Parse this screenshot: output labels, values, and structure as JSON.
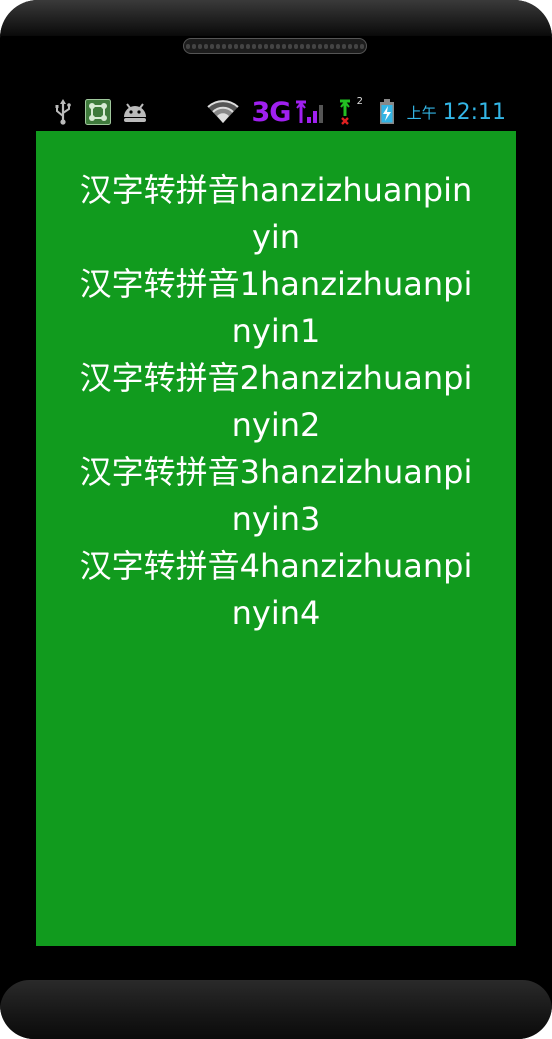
{
  "status_bar": {
    "icons": [
      "usb-icon",
      "app-notification-icon",
      "android-debug-icon",
      "wifi-icon",
      "network-3g-icon",
      "signal-icon",
      "sim-no-signal-icon",
      "battery-charging-icon"
    ],
    "network_label": "3G",
    "sim_slot_label": "2",
    "ampm": "上午",
    "time": "12:11"
  },
  "colors": {
    "screen_background": "#119b1e",
    "text": "#ffffff",
    "clock": "#33b5e5",
    "network_3g": "#a020f0"
  },
  "list": {
    "items": [
      {
        "chinese": "汉字转拼音",
        "pinyin": "hanzizhuanpinyin",
        "text": "汉字转拼音hanzizhuanpinyin"
      },
      {
        "chinese": "汉字转拼音1",
        "pinyin": "hanzizhuanpinyin1",
        "text": "汉字转拼音1hanzizhuanpinyin1"
      },
      {
        "chinese": "汉字转拼音2",
        "pinyin": "hanzizhuanpinyin2",
        "text": "汉字转拼音2hanzizhuanpinyin2"
      },
      {
        "chinese": "汉字转拼音3",
        "pinyin": "hanzizhuanpinyin3",
        "text": "汉字转拼音3hanzizhuanpinyin3"
      },
      {
        "chinese": "汉字转拼音4",
        "pinyin": "hanzizhuanpinyin4",
        "text": "汉字转拼音4hanzizhuanpinyin4"
      }
    ]
  }
}
